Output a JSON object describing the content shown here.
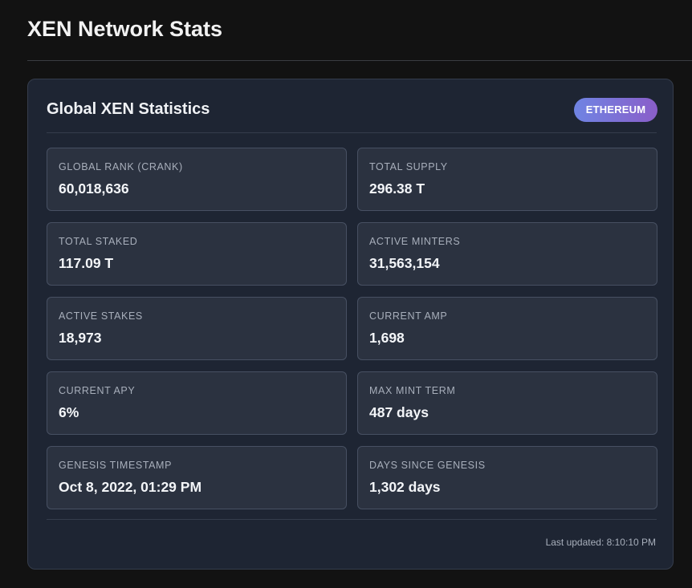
{
  "page": {
    "title": "XEN Network Stats"
  },
  "card": {
    "title": "Global XEN Statistics",
    "chain_badge": "ETHEREUM",
    "stats": [
      {
        "label": "GLOBAL RANK (CRANK)",
        "value": "60,018,636"
      },
      {
        "label": "TOTAL SUPPLY",
        "value": "296.38 T"
      },
      {
        "label": "TOTAL STAKED",
        "value": "117.09 T"
      },
      {
        "label": "ACTIVE MINTERS",
        "value": "31,563,154"
      },
      {
        "label": "ACTIVE STAKES",
        "value": "18,973"
      },
      {
        "label": "CURRENT AMP",
        "value": "1,698"
      },
      {
        "label": "CURRENT APY",
        "value": "6%"
      },
      {
        "label": "MAX MINT TERM",
        "value": "487 days"
      },
      {
        "label": "GENESIS TIMESTAMP",
        "value": "Oct 8, 2022, 01:29 PM"
      },
      {
        "label": "DAYS SINCE GENESIS",
        "value": "1,302 days"
      }
    ],
    "last_updated": "Last updated: 8:10:10 PM"
  },
  "colors": {
    "page_background": "#121212",
    "card_background": "#1e2533",
    "stat_box_background": "#2b3240",
    "badge_gradient_start": "#6f84e3",
    "badge_gradient_end": "#8a5ec9"
  }
}
